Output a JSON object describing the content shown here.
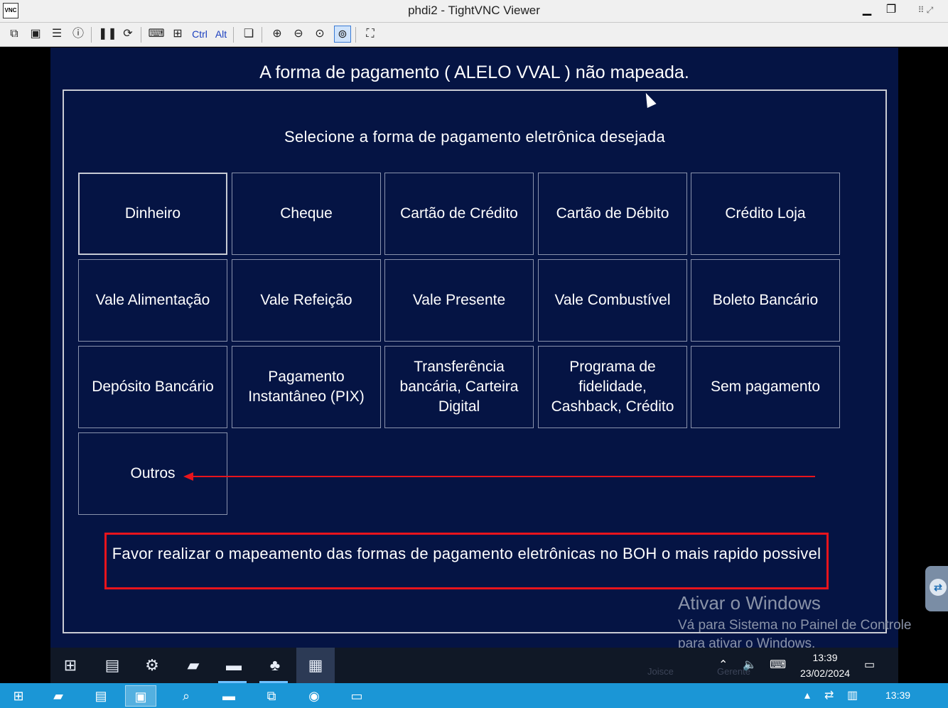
{
  "window": {
    "title": "phdi2 - TightVNC Viewer",
    "app_icon_label": "VNC",
    "minimize": "▁",
    "maximize": "❐",
    "close_glyphs": "⠿ ⤢"
  },
  "toolbar": {
    "ctrl_label": "Ctrl",
    "alt_label": "Alt"
  },
  "remote": {
    "header": "A forma de pagamento ( ALELO VVAL )  não mapeada.",
    "dialog_title": "Selecione a forma de pagamento eletrônica  desejada",
    "options": [
      "Dinheiro",
      "Cheque",
      "Cartão de Crédito",
      "Cartão de Débito",
      "Crédito Loja",
      "Vale Alimentação",
      "Vale Refeição",
      "Vale Presente",
      "Vale Combustível",
      "Boleto Bancário",
      "Depósito Bancário",
      "Pagamento Instantâneo (PIX)",
      "Transferência bancária, Carteira Digital",
      "Programa de fidelidade, Cashback, Crédito",
      "Sem pagamento",
      "Outros"
    ],
    "notice": "Favor realizar o mapeamento das formas de pagamento eletrônicas no BOH o mais rapido possivel",
    "watermark_title": "Ativar o Windows",
    "watermark_line1": "Vá para Sistema no Painel de Controle",
    "watermark_line2": "para ativar o Windows.",
    "taskbar": {
      "time": "13:39",
      "date": "23/02/2024",
      "ghost_user": "Joisce",
      "ghost_role": "Gerente"
    }
  },
  "local_taskbar": {
    "time": "13:39"
  },
  "colors": {
    "remote_bg": "#051444",
    "accent_red": "#e8141c",
    "local_taskbar": "#1b96d6"
  }
}
